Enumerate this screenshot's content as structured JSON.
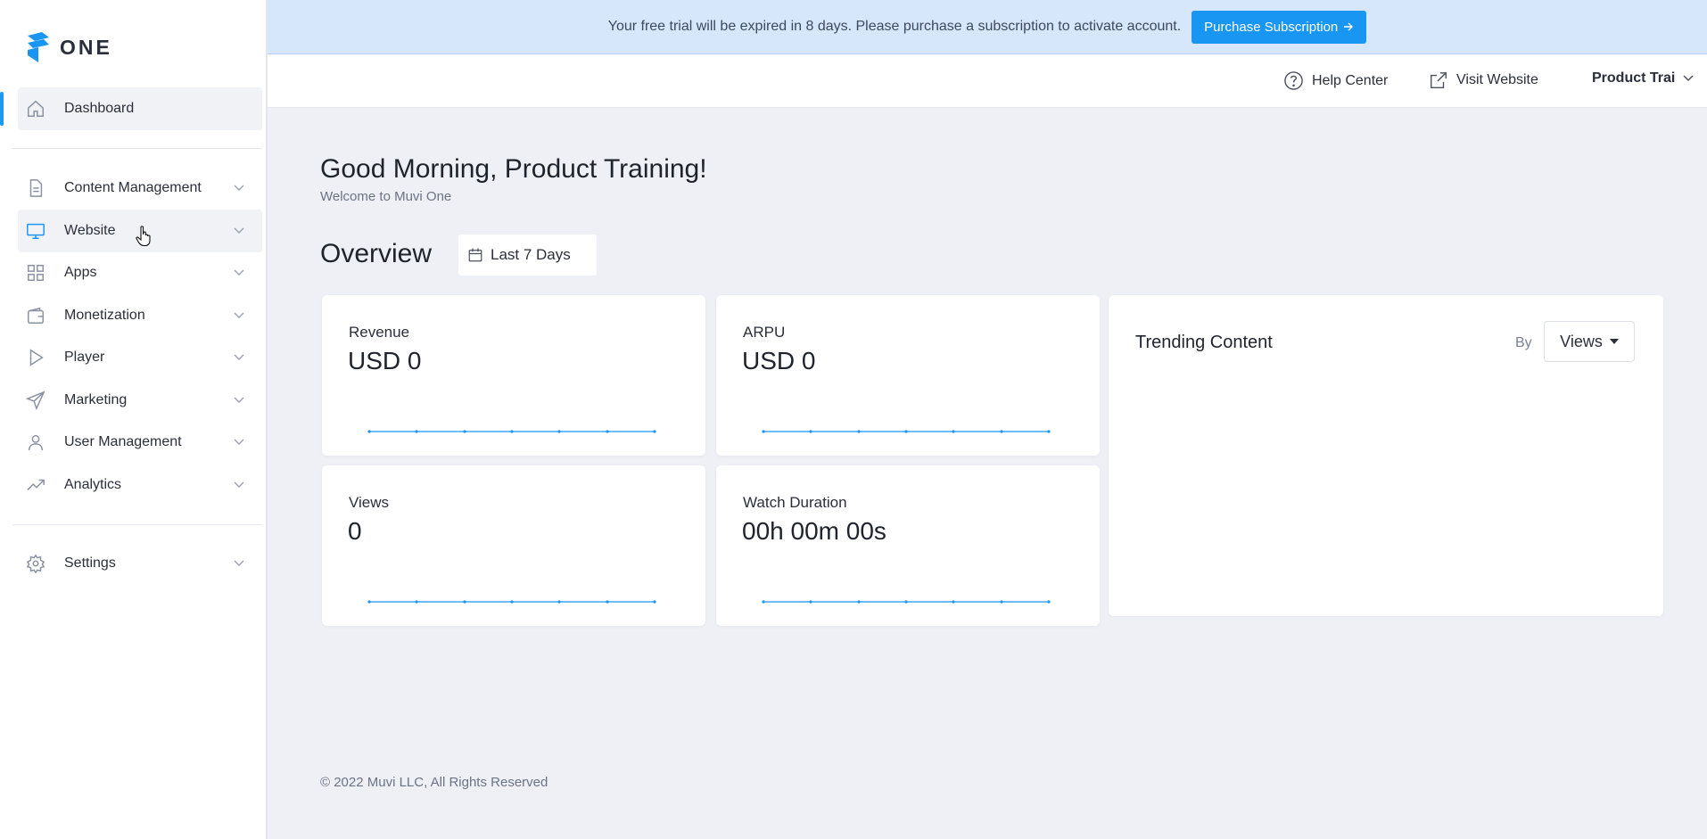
{
  "brand": {
    "logo_text": "ONE",
    "accent_color": "#1996f2"
  },
  "sidebar": {
    "items": [
      {
        "label": "Dashboard",
        "icon": "home-icon",
        "active": true
      },
      {
        "label": "Content Management",
        "icon": "document-icon"
      },
      {
        "label": "Website",
        "icon": "monitor-icon",
        "hovered": true
      },
      {
        "label": "Apps",
        "icon": "grid-icon"
      },
      {
        "label": "Monetization",
        "icon": "wallet-icon"
      },
      {
        "label": "Player",
        "icon": "play-icon"
      },
      {
        "label": "Marketing",
        "icon": "send-icon"
      },
      {
        "label": "User Management",
        "icon": "user-icon"
      },
      {
        "label": "Analytics",
        "icon": "trending-up-icon"
      },
      {
        "label": "Settings",
        "icon": "gear-icon"
      }
    ]
  },
  "banner": {
    "text": "Your free trial will be expired in 8 days. Please purchase a subscription to activate account.",
    "button_label": "Purchase Subscription"
  },
  "topbar": {
    "help_label": "Help Center",
    "visit_label": "Visit Website",
    "account_label": "Product Trai"
  },
  "main": {
    "greeting": "Good Morning, Product Training!",
    "welcome": "Welcome to Muvi One",
    "overview_title": "Overview",
    "date_range": "Last 7 Days"
  },
  "cards": [
    {
      "label": "Revenue",
      "value": "USD 0"
    },
    {
      "label": "ARPU",
      "value": "USD 0"
    },
    {
      "label": "Views",
      "value": "0"
    },
    {
      "label": "Watch Duration",
      "value": "00h 00m 00s"
    }
  ],
  "trending": {
    "title": "Trending Content",
    "by_label": "By",
    "sort_value": "Views"
  },
  "footer": {
    "copyright": "© 2022 Muvi LLC, All Rights Reserved"
  }
}
